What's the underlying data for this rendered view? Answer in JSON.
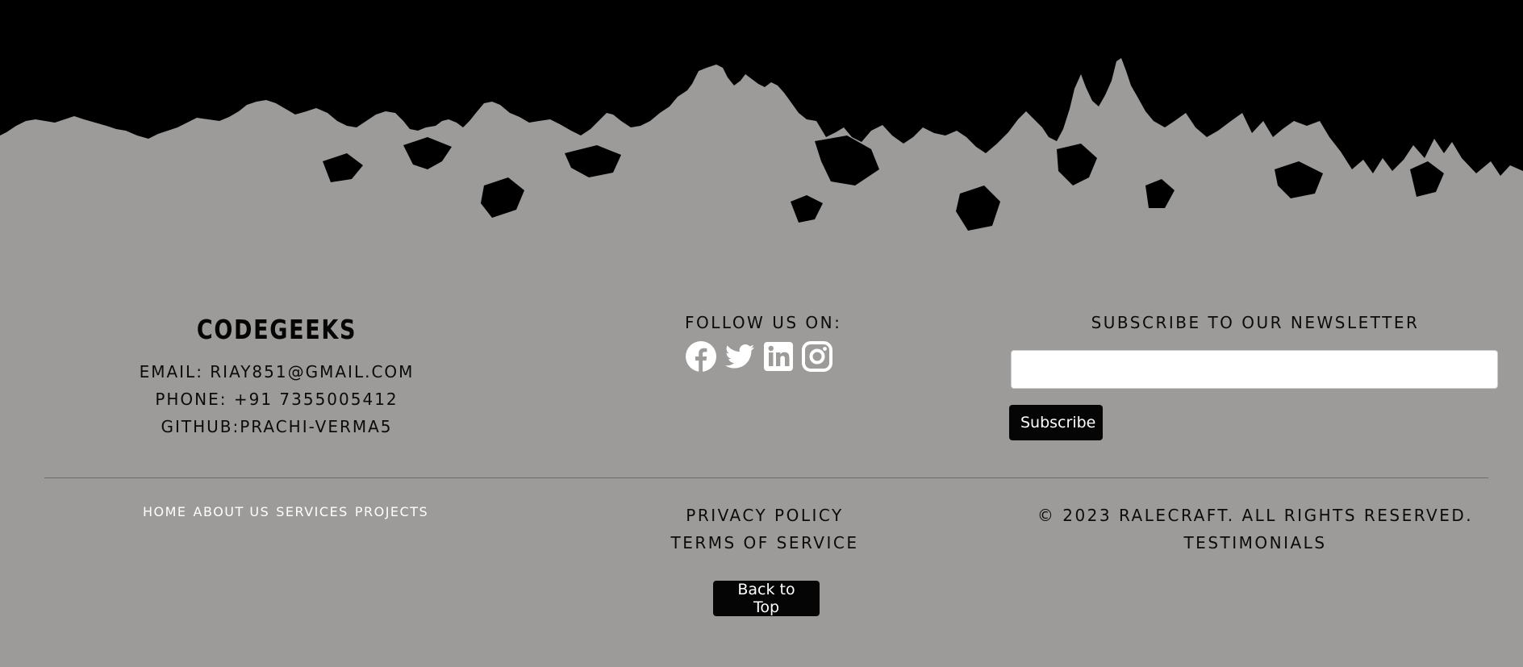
{
  "brand": {
    "name": "CODEGEEKS"
  },
  "contact": {
    "email": "EMAIL: RIAY851@GMAIL.COM",
    "phone": "PHONE: +91 7355005412",
    "github": "GITHUB:PRACHI-VERMA5"
  },
  "social": {
    "title": "FOLLOW US ON:",
    "icons": [
      "facebook-icon",
      "twitter-icon",
      "linkedin-icon",
      "instagram-icon"
    ]
  },
  "newsletter": {
    "title": "SUBSCRIBE TO OUR NEWSLETTER",
    "email_value": "",
    "button_label": "Subscribe"
  },
  "nav": {
    "links": [
      "HOME",
      "ABOUT US",
      "SERVICES",
      "PROJECTS"
    ]
  },
  "legal": {
    "privacy": "PRIVACY POLICY",
    "terms": "TERMS OF SERVICE"
  },
  "footer": {
    "copyright": "© 2023 RALECRAFT. ALL RIGHTS RESERVED.",
    "testimonials": "TESTIMONIALS",
    "back_to_top": "Back to Top"
  },
  "colors": {
    "background": "#9c9b9a",
    "top_band": "#000000",
    "button": "#050505",
    "nav_text": "#ffffff"
  }
}
